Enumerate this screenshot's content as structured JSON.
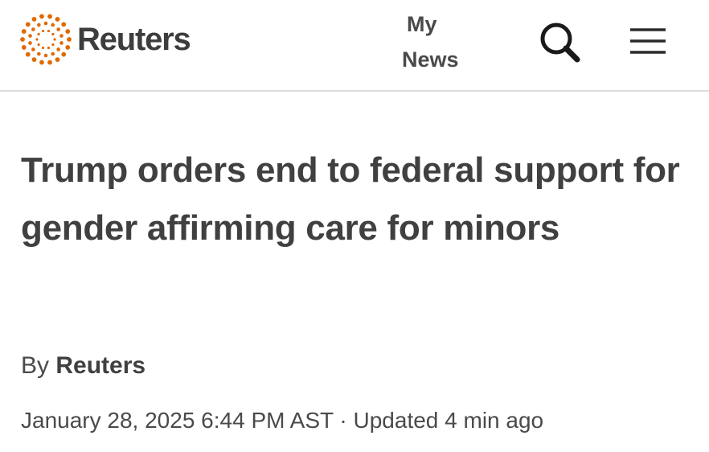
{
  "header": {
    "logo_text": "Reuters",
    "logo_icon": "reuters-dot-circle-icon",
    "brand_color": "#e06a00",
    "my_news_line1": "My",
    "my_news_line2": "News",
    "search_icon": "search-icon",
    "menu_icon": "hamburger-menu-icon"
  },
  "article": {
    "headline": "Trump orders end to federal support for gender affirming care for minors",
    "byline_prefix": "By ",
    "author": "Reuters",
    "published": "January 28, 2025 6:44 PM AST",
    "separator": " · ",
    "updated": "Updated 4 min ago"
  }
}
